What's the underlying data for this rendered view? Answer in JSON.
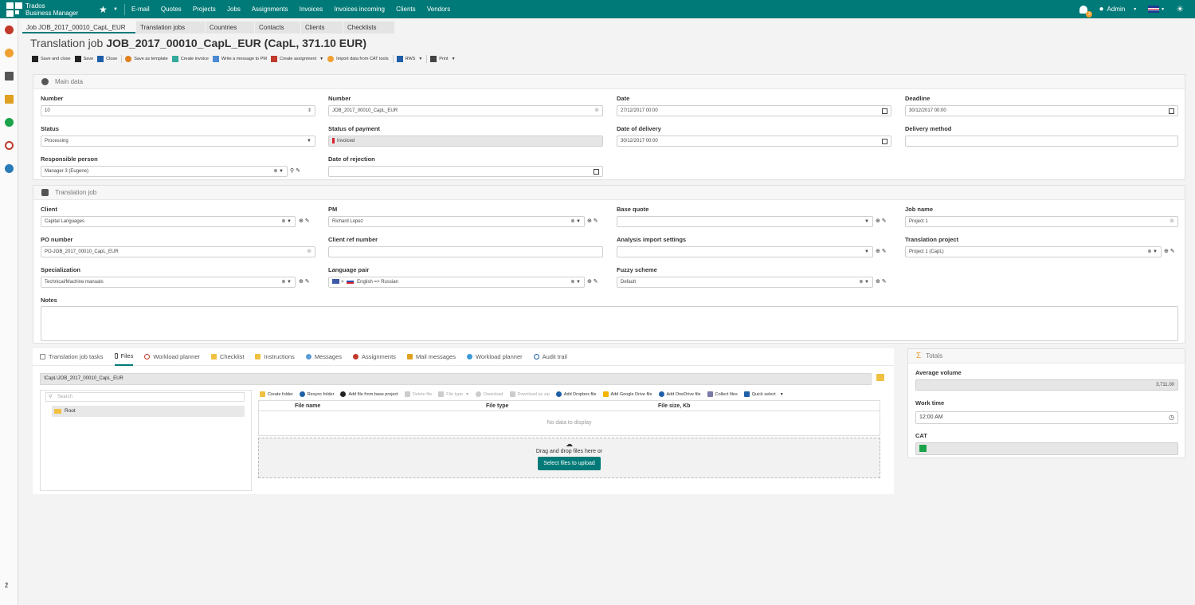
{
  "app": {
    "brand_line1": "Trados",
    "brand_line2": "Business Manager"
  },
  "topnav": [
    "E-mail",
    "Quotes",
    "Projects",
    "Jobs",
    "Assignments",
    "Invoices",
    "Invoices incoming",
    "Clients",
    "Vendors"
  ],
  "user": {
    "name": "Admin",
    "notifications": "2"
  },
  "doc_tabs": [
    "Job JOB_2017_00010_CapL_EUR",
    "Translation jobs",
    "Countries",
    "Contacts",
    "Clients",
    "Checklists"
  ],
  "title": {
    "prefix": "Translation job",
    "main": "JOB_2017_00010_CapL_EUR (CapL, 371.10 EUR)"
  },
  "toolbar": [
    "Save and close",
    "Save",
    "Close",
    "Save as template",
    "Create invoice",
    "Write a message to PM",
    "Create assignment",
    "Import data from CAT tools",
    "RWS",
    "Print"
  ],
  "main_data": {
    "header": "Main data",
    "number_label": "Number",
    "number_value": "10",
    "number2_label": "Number",
    "number2_value": "JOB_2017_00010_CapL_EUR",
    "date_label": "Date",
    "date_value": "27/12/2017 00:00",
    "deadline_label": "Deadline",
    "deadline_value": "30/12/2017 00:00",
    "status_label": "Status",
    "status_value": "Processing",
    "payment_label": "Status of payment",
    "payment_value": "Invoiced",
    "delivery_date_label": "Date of delivery",
    "delivery_date_value": "30/12/2017 00:00",
    "delivery_method_label": "Delivery method",
    "delivery_method_value": "",
    "resp_label": "Responsible person",
    "resp_value": "Manager 3 (Eugene)",
    "rejection_label": "Date of rejection",
    "rejection_value": ""
  },
  "translation_job": {
    "header": "Translation job",
    "client_label": "Client",
    "client_value": "Capital Languages",
    "pm_label": "PM",
    "pm_value": "Richard Lopez",
    "base_quote_label": "Base quote",
    "base_quote_value": "",
    "job_name_label": "Job name",
    "job_name_value": "Project 1",
    "po_label": "PO number",
    "po_value": "PO-JOB_2017_00010_CapL_EUR",
    "client_ref_label": "Client ref number",
    "client_ref_value": "",
    "analysis_label": "Analysis import settings",
    "analysis_value": "",
    "tproject_label": "Translation project",
    "tproject_value": "Project 1 (CapL)",
    "spec_label": "Specialization",
    "spec_value": "Technical/Machine manuals",
    "langpair_label": "Language pair",
    "langpair_value": "English => Russian",
    "fuzzy_label": "Fuzzy scheme",
    "fuzzy_value": "Default",
    "notes_label": "Notes",
    "notes_value": ""
  },
  "bottom_tabs": [
    "Translation job tasks",
    "Files",
    "Workload planner",
    "Checklist",
    "Instructions",
    "Messages",
    "Assignments",
    "Mail messages",
    "Workload planner",
    "Audit trail"
  ],
  "files": {
    "path": "\\CapL\\JOB_2017_00010_CapL_EUR",
    "search_placeholder": "Search",
    "root": "Root",
    "tools": [
      "Create folder",
      "Resync folder",
      "Add file from base project",
      "Delete file",
      "File type",
      "Download",
      "Download as zip",
      "Add Dropbox file",
      "Add Google Drive file",
      "Add OneDrive file",
      "Collect files",
      "Quick select"
    ],
    "columns": [
      "File name",
      "File type",
      "File size, Kb"
    ],
    "empty": "No data to display",
    "drop_text": "Drag and drop files here or",
    "upload_btn": "Select files to upload"
  },
  "totals": {
    "header": "Totals",
    "avg_label": "Average volume",
    "avg_value": "3,711.00",
    "work_label": "Work time",
    "work_value": "12:00 AM",
    "cat_label": "CAT"
  },
  "colors": {
    "accent": "#007a78"
  }
}
